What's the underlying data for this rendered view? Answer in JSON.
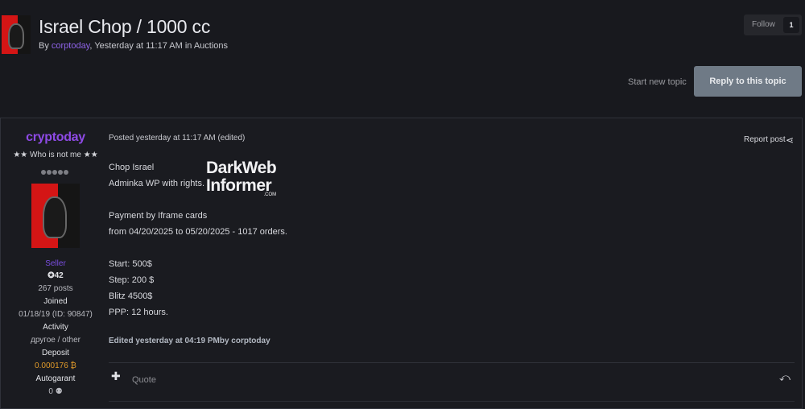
{
  "topic": {
    "title": "Israel Chop / 1000 cc",
    "by_prefix": "By ",
    "author": "corptoday",
    "meta_suffix": ", Yesterday at 11:17 AM in Auctions",
    "follow_label": "Follow",
    "follow_count": "1",
    "start_new_topic": "Start new topic",
    "reply_to_topic": "Reply to this topic"
  },
  "post": {
    "author": {
      "username": "cryptoday",
      "user_title": "★★ Who is not me ★★",
      "group": "Seller",
      "reputation": "42",
      "posts": "267 posts",
      "joined_label": "Joined",
      "joined_value": "01/18/19 (ID: 90847)",
      "activity_label": "Activity",
      "activity_value": "другое / other",
      "deposit_label": "Deposit",
      "deposit_value": "0.000176 ₿",
      "autogarant_label": "Autogarant",
      "autogarant_value": "0"
    },
    "meta": "Posted yesterday at 11:17 AM (edited)",
    "report": "Report post",
    "lines": [
      "Chop Israel",
      "Adminka WP with rights.",
      "",
      "Payment by Iframe cards",
      "from 04/20/2025 to 05/20/2025 - 1017 orders.",
      "",
      "Start: 500$",
      "Step: 200 $",
      "Blitz 4500$",
      "PPP: 12 hours."
    ],
    "logo": {
      "line1": "DarkWeb",
      "line2": "Informer",
      "line3": ".COM"
    },
    "edited_note": "Edited yesterday at 04:19 PMby corptoday",
    "quote_label": "Quote"
  },
  "icons": {
    "share": "share-icon",
    "plus": "plus-icon",
    "reply": "reply-icon",
    "reputation": "reputation-icon",
    "handshake": "handshake-icon"
  },
  "colors": {
    "background": "#18191e",
    "accent_purple": "#8e4ae6",
    "reply_button": "#6f7a86",
    "deposit": "#e09a2a"
  }
}
